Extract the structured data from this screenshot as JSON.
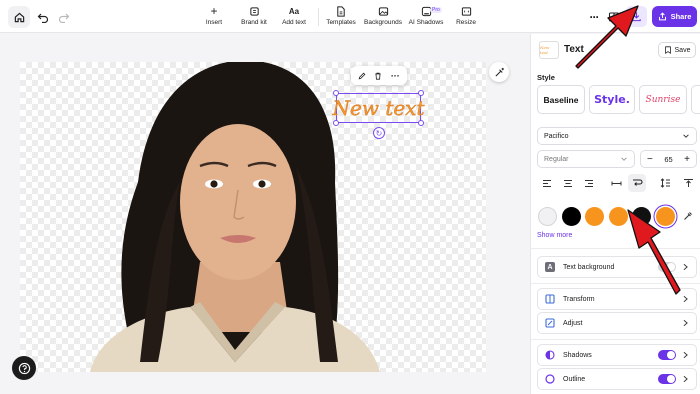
{
  "toolbar": {
    "tools": [
      {
        "label": "Insert"
      },
      {
        "label": "Brand kit"
      },
      {
        "label": "Add text"
      },
      {
        "label": "Templates"
      },
      {
        "label": "Backgrounds"
      },
      {
        "label": "AI Shadows"
      },
      {
        "label": "Resize"
      }
    ],
    "pro_badge": "Pro",
    "share_label": "Share"
  },
  "canvas": {
    "text_element": "New text"
  },
  "panel": {
    "title": "Text",
    "thumb_text": "New text",
    "save_label": "Save",
    "style_label": "Style",
    "styles": [
      {
        "label": "Baseline"
      },
      {
        "label": "Style."
      },
      {
        "label": "Sunrise"
      }
    ],
    "font": "Pacifico",
    "weight": "Regular",
    "size": "65",
    "size_minus": "−",
    "size_plus": "+",
    "swatches": [
      "#f1f1f3",
      "#000000",
      "#f7941d",
      "#f7941d",
      "#111111",
      "#f7941d"
    ],
    "selected_swatch_index": 5,
    "show_more": "Show more",
    "text_background": {
      "label": "Text background",
      "enabled": false
    },
    "transform_label": "Transform",
    "adjust_label": "Adjust",
    "shadows": {
      "label": "Shadows",
      "enabled": true
    },
    "outline": {
      "label": "Outline",
      "enabled": true
    }
  },
  "colors": {
    "accent": "#6b33e8",
    "text_color": "#f3962f",
    "annotation_arrow": "#e0191f"
  }
}
